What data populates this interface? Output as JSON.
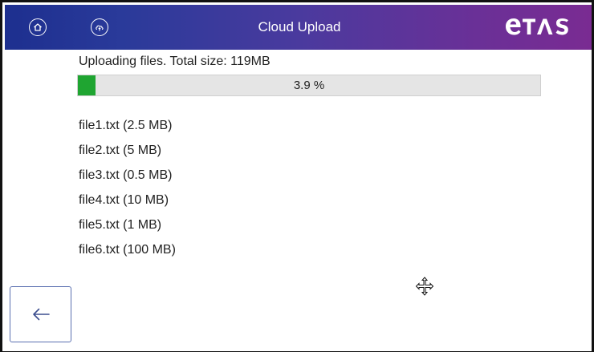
{
  "header": {
    "title": "Cloud Upload",
    "logo_text": "ETAS",
    "home_icon": "home-icon",
    "cloud_icon": "cloud-upload-icon",
    "gradient_start": "#1d2f8f",
    "gradient_end": "#7a2b92"
  },
  "upload": {
    "status_text": "Uploading files. Total size: 119MB",
    "progress_percent": 3.9,
    "progress_label": "3.9 %",
    "progress_color": "#1fa531"
  },
  "files": [
    "file1.txt (2.5 MB)",
    "file2.txt (5 MB)",
    "file3.txt (0.5 MB)",
    "file4.txt (10 MB)",
    "file5.txt (1 MB)",
    "file6.txt (100 MB)"
  ],
  "controls": {
    "back_icon": "arrow-left-icon",
    "cursor_icon": "move-cursor-icon"
  }
}
